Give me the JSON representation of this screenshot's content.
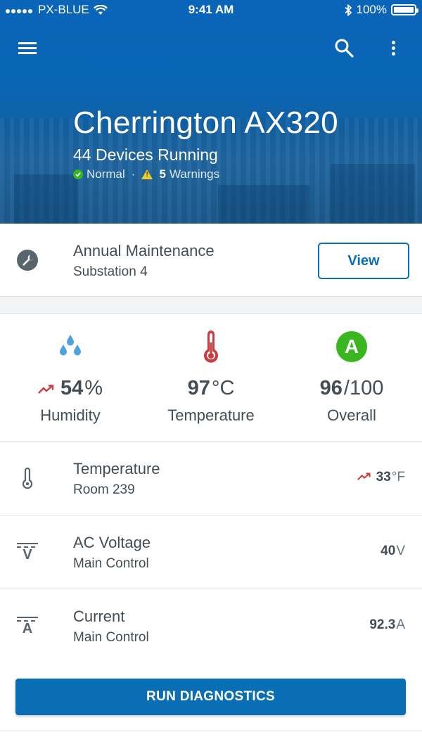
{
  "status_bar": {
    "carrier": "PX-BLUE",
    "time": "9:41 AM",
    "battery": "100%"
  },
  "header": {
    "title": "Cherrington AX320",
    "subtitle": "44 Devices Running",
    "status_text": "Normal",
    "separator": "·",
    "warning_count": "5",
    "warning_text": "Warnings",
    "icons": [
      "menu-icon",
      "search-icon",
      "more-vert-icon"
    ],
    "colors": {
      "primary": "#0a6eb4",
      "ok": "#39b620",
      "warning": "#f0cb2f"
    }
  },
  "maintenance": {
    "title": "Annual Maintenance",
    "subtitle": "Substation 4",
    "button_label": "View",
    "icon": "wrench-icon"
  },
  "stats": [
    {
      "icon": "humidity-icon",
      "trend": "trending-up",
      "value": "54",
      "unit": "%",
      "label": "Humidity"
    },
    {
      "icon": "thermometer-icon",
      "value": "97",
      "unit": "°C",
      "label": "Temperature"
    },
    {
      "icon": "grade-a-icon",
      "grade": "A",
      "value": "96",
      "unit": "/100",
      "label": "Overall"
    }
  ],
  "channels": [
    {
      "icon": "thermometer-outline-icon",
      "title": "Temperature",
      "subtitle": "Room 239",
      "trend": "trending-up",
      "value": "33",
      "unit": "°F"
    },
    {
      "icon": "voltage-icon",
      "symbol": "V",
      "title": "AC Voltage",
      "subtitle": "Main Control",
      "value": "40",
      "unit": "V"
    },
    {
      "icon": "current-icon",
      "symbol": "A",
      "title": "Current",
      "subtitle": "Main Control",
      "value": "92.3",
      "unit": "A"
    }
  ],
  "actions": {
    "diagnostics_label": "RUN DIAGNOSTICS"
  }
}
